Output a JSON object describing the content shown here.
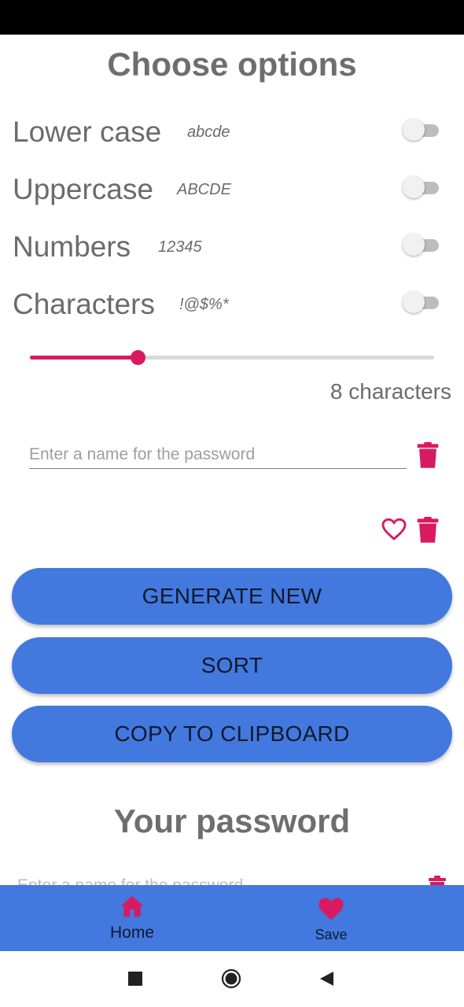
{
  "page": {
    "title": "Choose options"
  },
  "options": [
    {
      "label": "Lower case",
      "sample": "abcde",
      "enabled": false
    },
    {
      "label": "Uppercase",
      "sample": "ABCDE",
      "enabled": false
    },
    {
      "label": "Numbers",
      "sample": "12345",
      "enabled": false
    },
    {
      "label": "Characters",
      "sample": "!@$%*",
      "enabled": false
    }
  ],
  "length_slider": {
    "value": 8,
    "min": 0,
    "max": 30,
    "label": "8 characters"
  },
  "name_field": {
    "value": "",
    "placeholder": "Enter a name for the password"
  },
  "buttons": {
    "generate": "GENERATE NEW",
    "sort": "SORT",
    "copy": "COPY TO CLIPBOARD"
  },
  "result": {
    "title": "Your password",
    "peek_placeholder": "Enter a name for the password"
  },
  "bottom_nav": {
    "items": [
      {
        "label": "Home",
        "icon": "home-icon"
      },
      {
        "label": "Save",
        "icon": "heart-icon"
      }
    ]
  },
  "system_nav": {
    "icons": [
      "recents-icon",
      "home-circle-icon",
      "back-icon"
    ]
  },
  "colors": {
    "accent": "#d81b60",
    "primary": "#4378df",
    "status_bar": "#000000",
    "text_gray": "#6b6b6b"
  }
}
